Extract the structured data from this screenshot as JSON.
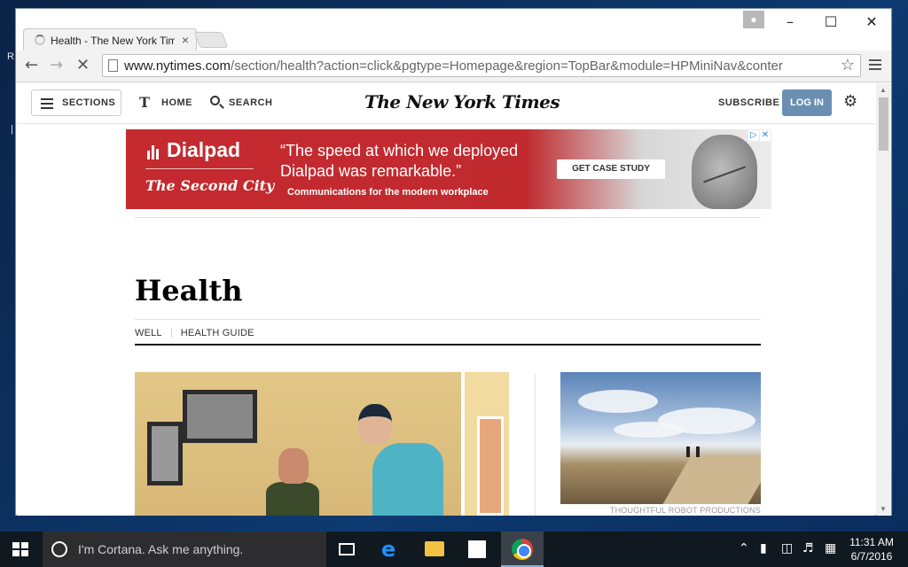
{
  "browser": {
    "tab": {
      "title": "Health - The New York Times"
    },
    "url": {
      "host": "www.nytimes.com",
      "path": "/section/health?action=click&pgtype=Homepage&region=TopBar&module=HPMiniNav&conter"
    }
  },
  "site": {
    "sections_label": "SECTIONS",
    "home_label": "HOME",
    "search_label": "SEARCH",
    "logo": "The New York Times",
    "subscribe_label": "SUBSCRIBE",
    "login_label": "LOG IN"
  },
  "ad": {
    "brand": "Dialpad",
    "partner": "The Second City",
    "quote": "“The speed at which we deployed Dialpad was remarkable.”",
    "tagline": "Communications for the modern workplace",
    "cta": "GET CASE STUDY"
  },
  "section": {
    "title": "Health",
    "subnav": [
      "WELL",
      "HEALTH GUIDE"
    ]
  },
  "side_story": {
    "photo_credit": "THOUGHTFUL ROBOT PRODUCTIONS"
  },
  "taskbar": {
    "cortana_placeholder": "I'm Cortana. Ask me anything.",
    "time": "11:31 AM",
    "date": "6/7/2016"
  },
  "colors": {
    "login_button": "#6a8fb3",
    "ad_red": "#c52a2f",
    "taskbar": "#101820"
  }
}
